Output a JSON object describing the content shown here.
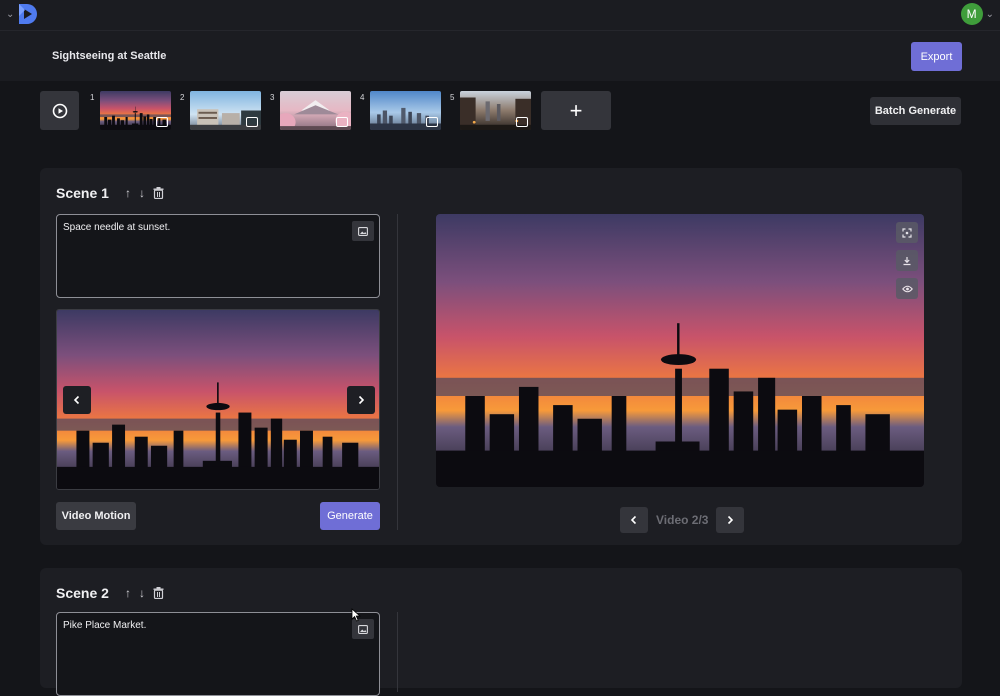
{
  "app": {
    "avatar_initial": "M",
    "colors": {
      "accent": "#6f6ed6",
      "background": "#141519",
      "panel": "#1d1e23",
      "avatar": "#3f9d3b"
    }
  },
  "header": {
    "project_title": "Sightseeing at Seattle",
    "export_label": "Export"
  },
  "storyboard": {
    "play_icon": "play-circle-icon",
    "thumbnails": [
      {
        "number": "1",
        "media": "video-icon"
      },
      {
        "number": "2",
        "media": "image-icon"
      },
      {
        "number": "3",
        "media": "video-icon"
      },
      {
        "number": "4",
        "media": "video-icon"
      },
      {
        "number": "5",
        "media": "image-icon"
      }
    ],
    "add_label": "+",
    "batch_label": "Batch Generate"
  },
  "scenes": [
    {
      "title": "Scene 1",
      "prompt": "Space needle at sunset.",
      "motion_label": "Video Motion",
      "generate_label": "Generate",
      "pager_label": "Video 2/3"
    },
    {
      "title": "Scene 2",
      "prompt": "Pike Place Market."
    }
  ]
}
